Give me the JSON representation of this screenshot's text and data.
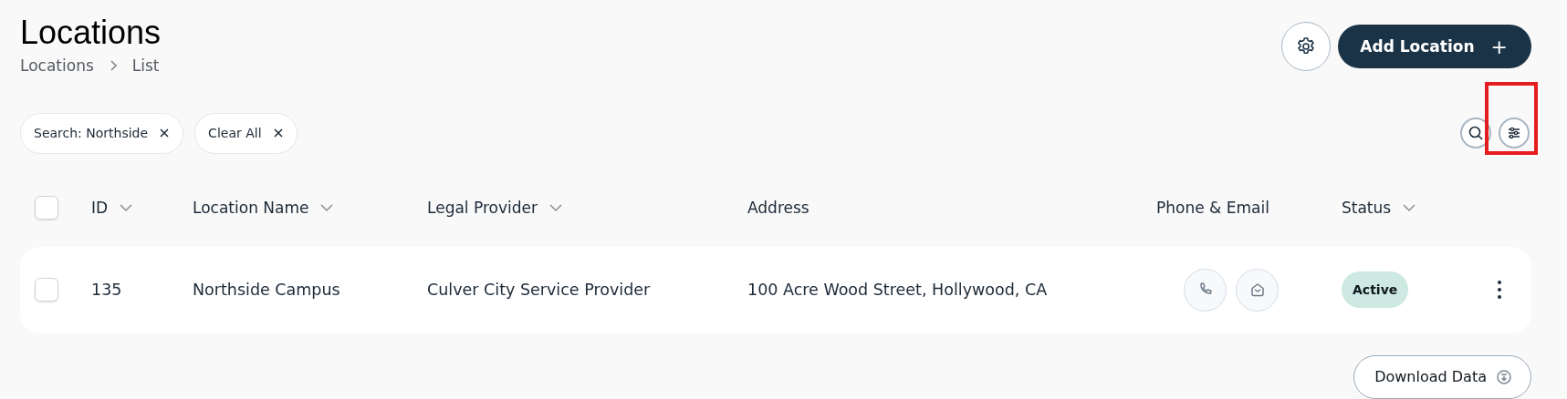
{
  "page": {
    "title": "Locations",
    "breadcrumb": [
      "Locations",
      "List"
    ]
  },
  "actions": {
    "add_button": "Add Location",
    "add_icon": "+"
  },
  "filters": [
    {
      "label": "Search: Northside"
    },
    {
      "label": "Clear All"
    }
  ],
  "tools": {
    "filter_highlighted": true
  },
  "table": {
    "columns": [
      {
        "label": "ID",
        "sortable": true
      },
      {
        "label": "Location Name",
        "sortable": true
      },
      {
        "label": "Legal Provider",
        "sortable": true
      },
      {
        "label": "Address",
        "sortable": false
      },
      {
        "label": "Phone & Email",
        "sortable": false
      },
      {
        "label": "Status",
        "sortable": true
      }
    ],
    "rows": [
      {
        "checked": false,
        "id": "135",
        "name": "Northside Campus",
        "provider": "Culver City Service Provider",
        "address": "100 Acre Wood Street, Hollywood, CA",
        "status": "Active",
        "color": "#cde9e1"
      }
    ],
    "header_checked": false
  },
  "download_button": "Download Data"
}
